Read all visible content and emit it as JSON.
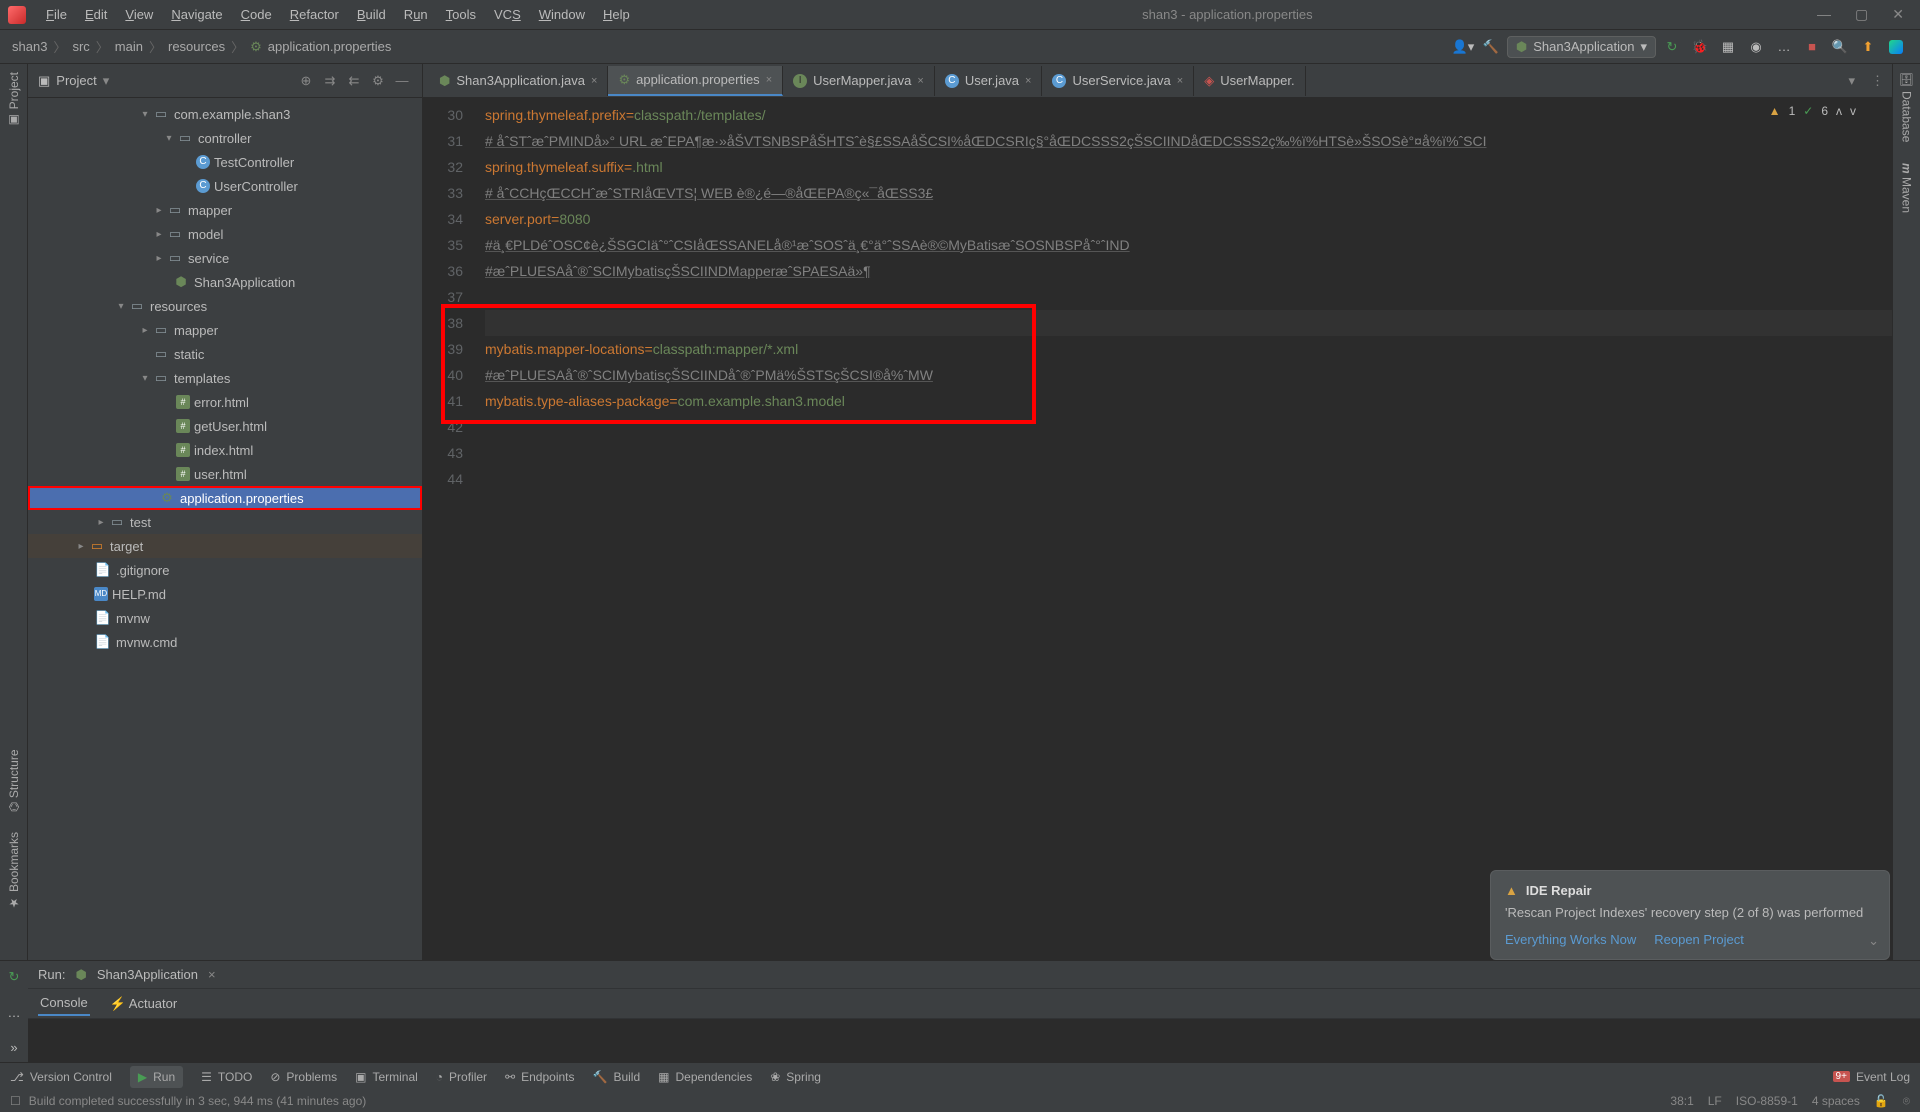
{
  "title": "shan3 - application.properties",
  "menu": [
    "File",
    "Edit",
    "View",
    "Navigate",
    "Code",
    "Refactor",
    "Build",
    "Run",
    "Tools",
    "VCS",
    "Window",
    "Help"
  ],
  "breadcrumb": [
    "shan3",
    "src",
    "main",
    "resources",
    "application.properties"
  ],
  "runConfig": "Shan3Application",
  "projectLabel": "Project",
  "tree": {
    "pkg": "com.example.shan3",
    "controller": "controller",
    "testController": "TestController",
    "userController": "UserController",
    "mapper": "mapper",
    "model": "model",
    "service": "service",
    "shanApp": "Shan3Application",
    "resources": "resources",
    "resMapper": "mapper",
    "static": "static",
    "templates": "templates",
    "errorHtml": "error.html",
    "getUserHtml": "getUser.html",
    "indexHtml": "index.html",
    "userHtml": "user.html",
    "appProps": "application.properties",
    "test": "test",
    "target": "target",
    "gitignore": ".gitignore",
    "help": "HELP.md",
    "mvnw": "mvnw",
    "mvnwCmd": "mvnw.cmd"
  },
  "tabs": [
    {
      "label": "Shan3Application.java",
      "icon": "cls"
    },
    {
      "label": "application.properties",
      "icon": "prop",
      "active": true
    },
    {
      "label": "UserMapper.java",
      "icon": "int"
    },
    {
      "label": "User.java",
      "icon": "cls"
    },
    {
      "label": "UserService.java",
      "icon": "cls"
    },
    {
      "label": "UserMapper.",
      "icon": "xml"
    }
  ],
  "inspections": {
    "warnings": "1",
    "ok": "6"
  },
  "code": {
    "lines": [
      30,
      31,
      32,
      33,
      34,
      35,
      36,
      37,
      38,
      39,
      40,
      41,
      42,
      43,
      44
    ],
    "l30k": "spring.thymeleaf.prefix",
    "l30v": "classpath:/templates/",
    "l31": "# åˆSTˆæˆPMINDå»° URL æˆEPA¶æ·»åŠVTSNBSPåŠHTSˆè§£SSAåŠCSI%åŒDCSRIç§°åŒDCSSS2çŠSCIINDåŒDCSSS2ç‰%ï%HTSè»ŠSOSè°¤å%ï%ˆSCI",
    "l32k": "spring.thymeleaf.suffix",
    "l32v": ".html",
    "l33": "# åˆCCHçŒCCHˆæˆSTRIåŒVTS¦ WEB è®¿é—®åŒEPA®ç«¯åŒSS3£",
    "l34k": "server.port",
    "l34v": "8080",
    "l35": "#ä¸€PLDéˆOSC¢è¿ŠSGCIäˆ°ˆCSIåŒSSANELå®¹æˆSOSˆä¸€°ä°ˆSSAè®©MyBatisæˆSOSNBSPåˆ°ˆIND",
    "l36": "#æˆPLUESAåˆ®ˆSCIMybatisçŠSCIINDMapperæˆSPAESAä»¶",
    "l39k": "mybatis.mapper-locations",
    "l39v": "classpath:mapper/*.xml",
    "l40": "#æˆPLUESAåˆ®ˆSCIMybatisçŠSCIINDåˆ®ˆPMä%ŠSTSçŠCSI®å%ˆMW",
    "l41k": "mybatis.type-aliases-package",
    "l41v": "com.example.shan3.model"
  },
  "runPanel": {
    "title": "Run:",
    "config": "Shan3Application",
    "tabs": [
      "Console",
      "Actuator"
    ]
  },
  "notification": {
    "title": "IDE Repair",
    "body": "'Rescan Project Indexes' recovery step (2 of 8) was performed",
    "action1": "Everything Works Now",
    "action2": "Reopen Project"
  },
  "bottomTools": [
    "Version Control",
    "Run",
    "TODO",
    "Problems",
    "Terminal",
    "Profiler",
    "Endpoints",
    "Build",
    "Dependencies",
    "Spring"
  ],
  "eventLog": "Event Log",
  "status": {
    "msg": "Build completed successfully in 3 sec, 944 ms (41 minutes ago)",
    "pos": "38:1",
    "lf": "LF",
    "enc": "ISO-8859-1",
    "indent": "4 spaces"
  },
  "sideLabels": {
    "project": "Project",
    "structure": "Structure",
    "bookmarks": "Bookmarks",
    "database": "Database",
    "maven": "Maven"
  }
}
